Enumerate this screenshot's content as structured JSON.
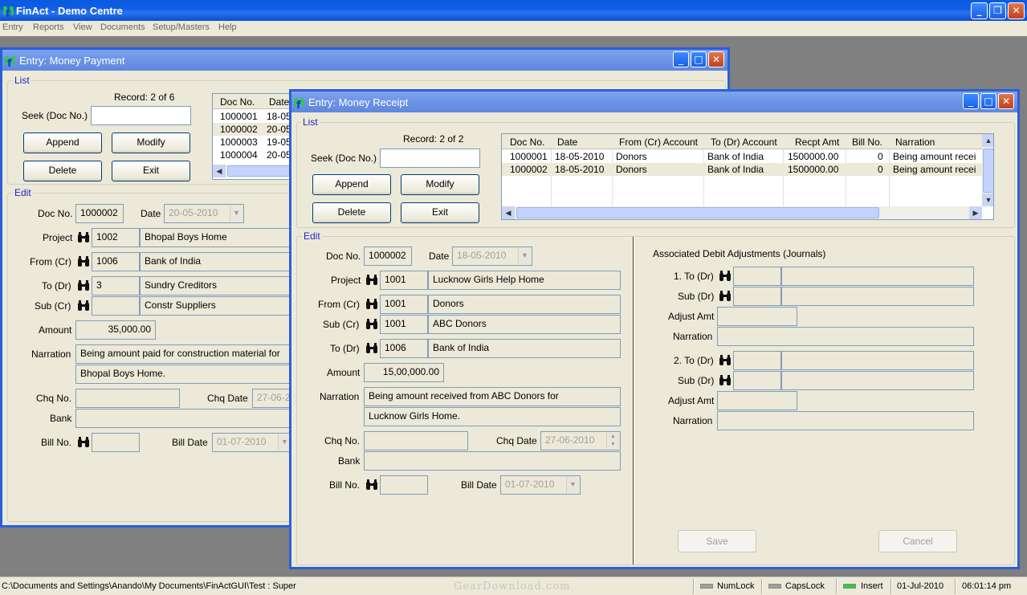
{
  "app": {
    "title": "FinAct - Demo Centre"
  },
  "menu": [
    "Entry",
    "Reports",
    "View",
    "Documents",
    "Setup/Masters",
    "Help"
  ],
  "payment": {
    "title": "Entry: Money Payment",
    "list_label": "List",
    "record": "Record: 2 of 6",
    "seek_label": "Seek (Doc No.)",
    "buttons": {
      "append": "Append",
      "modify": "Modify",
      "delete": "Delete",
      "exit": "Exit"
    },
    "grid": {
      "headers": [
        "Doc No.",
        "Date"
      ],
      "rows": [
        [
          "1000001",
          "18-05"
        ],
        [
          "1000002",
          "20-05"
        ],
        [
          "1000003",
          "19-05"
        ],
        [
          "1000004",
          "20-05"
        ]
      ]
    },
    "edit_label": "Edit",
    "doc_no_label": "Doc No.",
    "doc_no": "1000002",
    "date_label": "Date",
    "date": "20-05-2010",
    "project_label": "Project",
    "project_code": "1002",
    "project_name": "Bhopal Boys Home",
    "from_label": "From (Cr)",
    "from_code": "1006",
    "from_name": "Bank of India",
    "to_label": "To (Dr)",
    "to_code": "3",
    "to_name": "Sundry Creditors",
    "sub_label": "Sub (Cr)",
    "sub_code": "",
    "sub_name": "Constr Suppliers",
    "amount_label": "Amount",
    "amount": "35,000.00",
    "narration_label": "Narration",
    "narration1": "Being amount paid for construction material for",
    "narration2": "Bhopal Boys Home.",
    "chq_no_label": "Chq No.",
    "chq_date_label": "Chq Date",
    "chq_date": "27-06-2",
    "bank_label": "Bank",
    "bill_no_label": "Bill No.",
    "bill_date_label": "Bill Date",
    "bill_date": "01-07-2010"
  },
  "receipt": {
    "title": "Entry: Money Receipt",
    "list_label": "List",
    "record": "Record: 2 of 2",
    "seek_label": "Seek (Doc No.)",
    "buttons": {
      "append": "Append",
      "modify": "Modify",
      "delete": "Delete",
      "exit": "Exit",
      "save": "Save",
      "cancel": "Cancel"
    },
    "grid": {
      "headers": [
        "Doc No.",
        "Date",
        "From (Cr) Account",
        "To (Dr) Account",
        "Recpt Amt",
        "Bill No.",
        "Narration"
      ],
      "rows": [
        [
          "1000001",
          "18-05-2010",
          "Donors",
          "Bank of India",
          "1500000.00",
          "0",
          "Being amount recei"
        ],
        [
          "1000002",
          "18-05-2010",
          "Donors",
          "Bank of India",
          "1500000.00",
          "0",
          "Being amount recei"
        ]
      ]
    },
    "edit_label": "Edit",
    "doc_no_label": "Doc No.",
    "doc_no": "1000002",
    "date_label": "Date",
    "date": "18-05-2010",
    "project_label": "Project",
    "project_code": "1001",
    "project_name": "Lucknow Girls Help Home",
    "from_label": "From (Cr)",
    "from_code": "1001",
    "from_name": "Donors",
    "sub_label": "Sub (Cr)",
    "sub_code": "1001",
    "sub_name": "ABC Donors",
    "to_label": "To (Dr)",
    "to_code": "1006",
    "to_name": "Bank of India",
    "amount_label": "Amount",
    "amount": "15,00,000.00",
    "narration_label": "Narration",
    "narration1": "Being amount received from ABC Donors for",
    "narration2": "Lucknow Girls Home.",
    "chq_no_label": "Chq No.",
    "chq_date_label": "Chq Date",
    "chq_date": "27-06-2010",
    "bank_label": "Bank",
    "bill_no_label": "Bill No.",
    "bill_date_label": "Bill Date",
    "bill_date": "01-07-2010",
    "assoc": {
      "title": "Associated Debit Adjustments (Journals)",
      "to1": "1. To (Dr)",
      "sub1": "Sub (Dr)",
      "adj1": "Adjust Amt",
      "narr1": "Narration",
      "to2": "2. To (Dr)",
      "sub2": "Sub (Dr)",
      "adj2": "Adjust Amt",
      "narr2": "Narration"
    }
  },
  "status": {
    "path": "C:\\Documents and Settings\\Anando\\My Documents\\FinActGUI\\Test : Super",
    "watermark": "GearDownload.com",
    "numlock": "NumLock",
    "capslock": "CapsLock",
    "insert": "Insert",
    "date": "01-Jul-2010",
    "time": "06:01:14 pm"
  },
  "colors": {
    "title_blue": "#0a5be0",
    "inactive_title": "#7ea4ef",
    "group_label": "#2323c8",
    "led_on": "#2ecc40"
  }
}
